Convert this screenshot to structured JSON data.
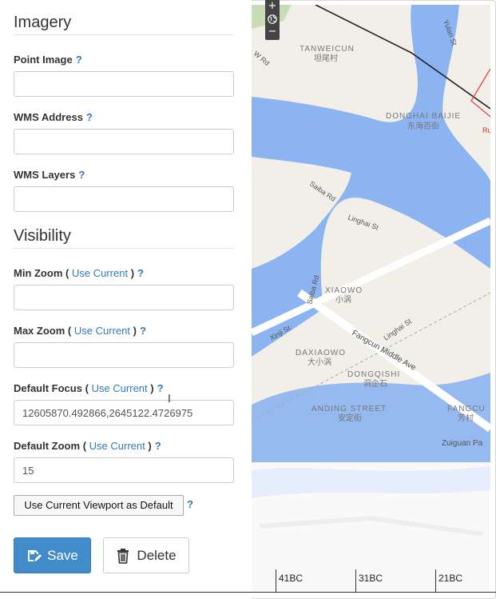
{
  "imagery": {
    "title": "Imagery",
    "point_image": {
      "label": "Point Image",
      "help": "?",
      "value": ""
    },
    "wms_address": {
      "label": "WMS Address",
      "help": "?",
      "value": ""
    },
    "wms_layers": {
      "label": "WMS Layers",
      "help": "?",
      "value": ""
    }
  },
  "visibility": {
    "title": "Visibility",
    "min_zoom": {
      "label": "Min Zoom",
      "open": "(",
      "link": "Use Current",
      "close": ")",
      "help": "?",
      "value": ""
    },
    "max_zoom": {
      "label": "Max Zoom",
      "open": "(",
      "link": "Use Current",
      "close": ")",
      "help": "?",
      "value": ""
    },
    "default_focus": {
      "label": "Default Focus",
      "open": "(",
      "link": "Use Current",
      "close": ")",
      "help": "?",
      "value": "12605870.492866,2645122.4726975"
    },
    "default_zoom": {
      "label": "Default Zoom",
      "open": "(",
      "link": "Use Current",
      "close": ")",
      "help": "?",
      "value": "15"
    },
    "viewport_button": "Use Current Viewport as Default",
    "viewport_help": "?"
  },
  "actions": {
    "save": "Save",
    "delete": "Delete"
  },
  "map": {
    "zoom_in": "+",
    "zoom_out": "−",
    "labels": {
      "tanweicun": "TANWEICUN",
      "tanweicun_cn": "坦尾村",
      "donghai": "DONGHAI BAIJIE",
      "donghai_cn": "东海百街",
      "saiba_rd_n": "Saiba Rd",
      "linghai_st": "Linghai St",
      "xiaowo": "XIAOWO",
      "xiaowo_cn": "小涡",
      "saiba_rd": "Saiba Rd",
      "linghai_st2": "Linghai St",
      "xinji_st": "Xinji St",
      "fangcun_middle": "Fangcun Middle Ave",
      "daxiaowo": "DAXIAOWO",
      "daxiaowo_cn": "大小涡",
      "dongqishi": "DONGQISHI",
      "dongqishi_cn": "洞企石",
      "anding": "ANDING STREET",
      "anding_cn": "安定街",
      "fangcun": "FANGCU",
      "fangcun_cn": "芳村",
      "zuiguan": "Zuiguan Pa",
      "yulan_st": "Yulan St",
      "w_rd": "W Rd",
      "ru": "Ru",
      "chuihai": "hai St"
    },
    "colors": {
      "land": "#f2efe9",
      "water": "#8cb4f1",
      "road": "#ffffff",
      "park": "#c7ddb5"
    }
  },
  "timeline": {
    "ticks": [
      "41BC",
      "31BC",
      "21BC"
    ]
  }
}
